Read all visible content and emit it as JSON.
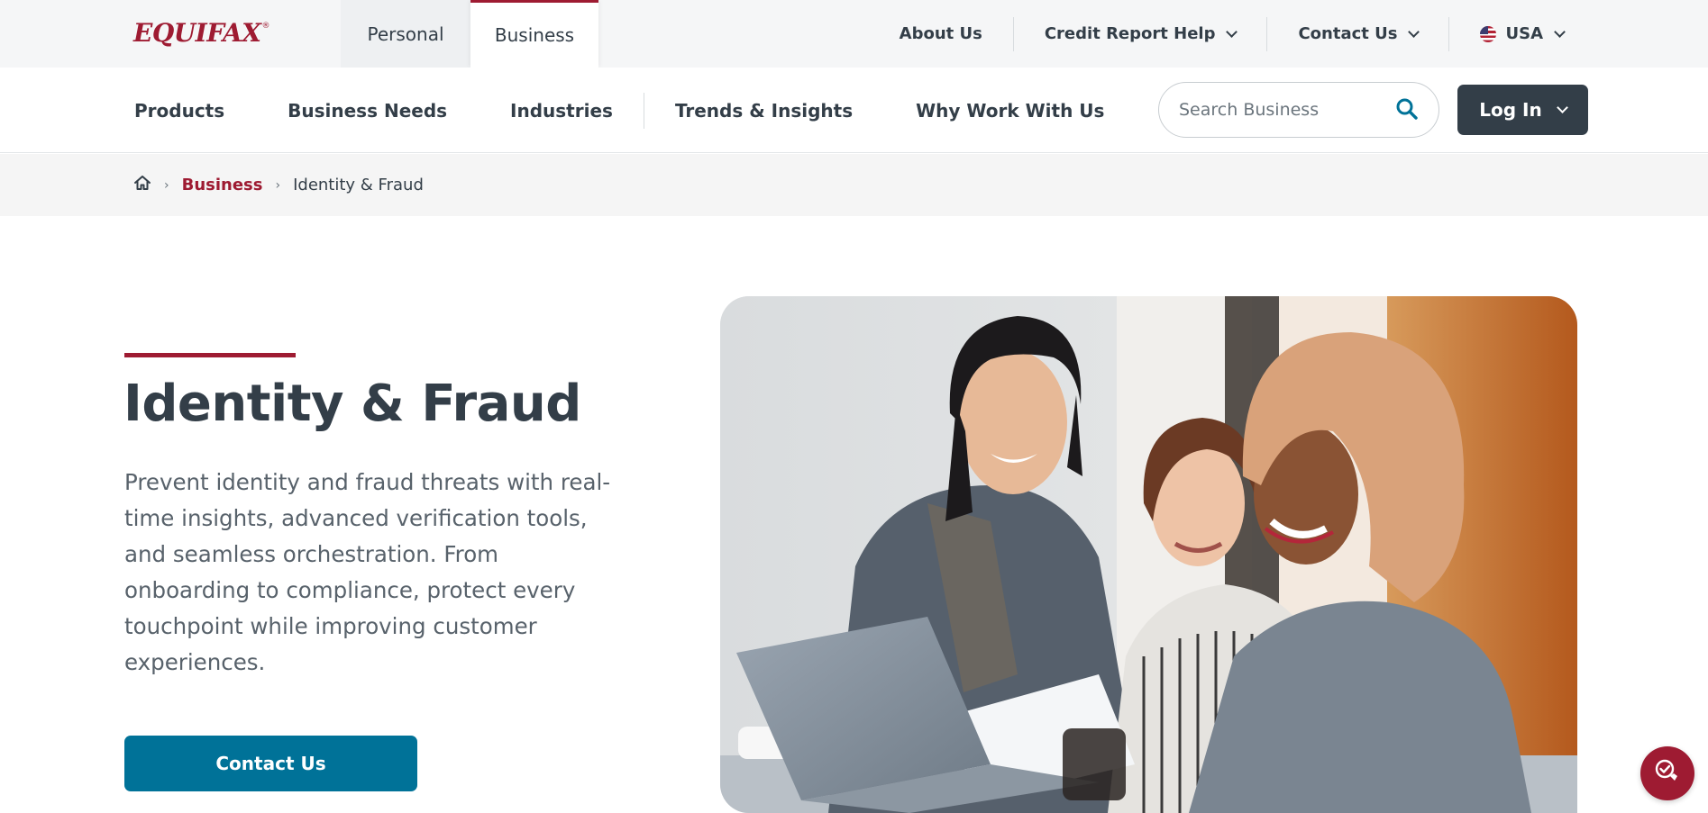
{
  "brand": {
    "logo_text": "EQUIFAX",
    "logo_mark": "®",
    "accent_color": "#9e1b32",
    "dark_color": "#333e48",
    "cta_color": "#007298"
  },
  "segments": {
    "personal": "Personal",
    "business": "Business",
    "active": "Business"
  },
  "utility_nav": {
    "about": "About Us",
    "credit_help": "Credit Report Help",
    "contact": "Contact Us",
    "country": "USA"
  },
  "main_nav": {
    "items": [
      "Products",
      "Business Needs",
      "Industries",
      "Trends & Insights",
      "Why Work With Us"
    ]
  },
  "search": {
    "placeholder": "Search Business",
    "value": ""
  },
  "login": {
    "label": "Log In"
  },
  "breadcrumb": {
    "home_icon": "home-icon",
    "separator": "›",
    "items": [
      "Business",
      "Identity & Fraud"
    ]
  },
  "hero": {
    "title": "Identity & Fraud",
    "description": "Prevent identity and fraud threats with real-time insights, advanced verification tools, and seamless orchestration. From onboarding to compliance, protect every touchpoint while improving customer experiences.",
    "cta_label": "Contact Us",
    "image_subject": "three-women-at-laptop-photo"
  },
  "chat": {
    "icon": "chat-help-icon"
  }
}
